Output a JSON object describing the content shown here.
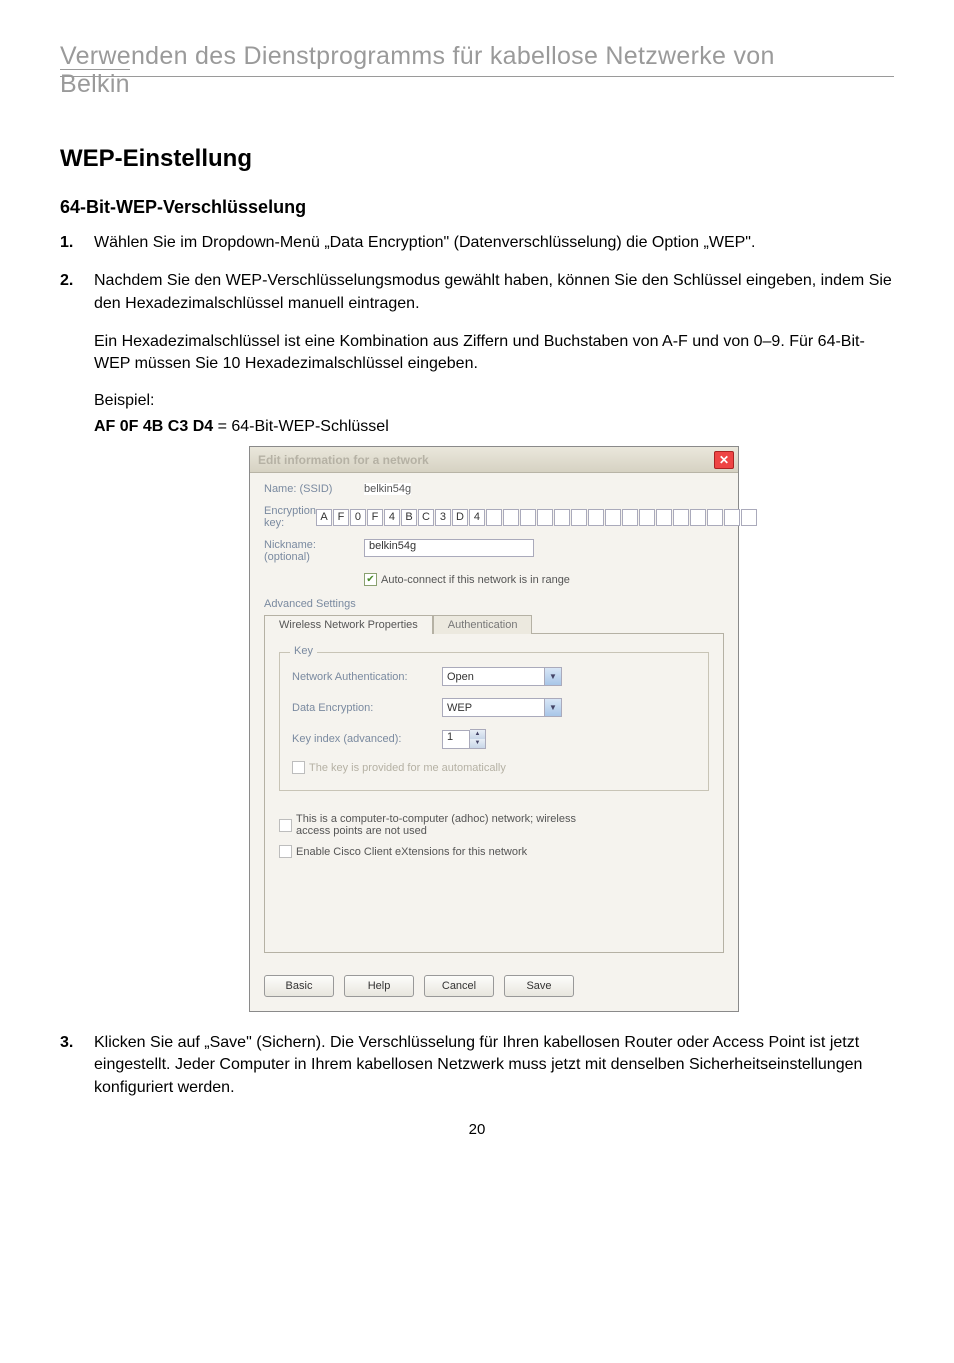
{
  "header": {
    "title": "Verwenden des Dienstprogramms für kabellose Netzwerke von",
    "sub": "Belkin"
  },
  "section_title": "WEP-Einstellung",
  "subheading": "64-Bit-WEP-Verschlüsselung",
  "steps": {
    "s1": {
      "num": "1.",
      "text": "Wählen Sie im Dropdown-Menü „Data Encryption\" (Datenverschlüsselung) die Option „WEP\"."
    },
    "s2": {
      "num": "2.",
      "text": "Nachdem Sie den WEP-Verschlüsselungsmodus gewählt haben, können Sie den Schlüssel eingeben, indem Sie den Hexadezimalschlüssel manuell eintragen."
    },
    "s3": {
      "num": "3.",
      "text": "Klicken Sie auf „Save\" (Sichern). Die Verschlüsselung für Ihren kabellosen Router oder Access Point ist jetzt eingestellt. Jeder Computer in Ihrem kabellosen Netzwerk muss jetzt mit denselben Sicherheitseinstellungen konfiguriert werden."
    }
  },
  "para_hex": "Ein Hexadezimalschlüssel ist eine Kombination aus Ziffern und Buchstaben von A-F und von 0–9. Für 64-Bit-WEP  müssen Sie 10 Hexadezimalschlüssel eingeben.",
  "para_example": "Beispiel:",
  "keyline": {
    "bold": "AF 0F 4B C3 D4",
    "rest": " = 64-Bit-WEP-Schlüssel"
  },
  "dialog": {
    "title": "Edit information for a network",
    "name_label": "Name: (SSID)",
    "name_value": "belkin54g",
    "enc_label": "Encryption key:",
    "enc_cells": [
      "A",
      "F",
      "0",
      "F",
      "4",
      "B",
      "C",
      "3",
      "D",
      "4",
      "",
      "",
      "",
      "",
      "",
      "",
      "",
      "",
      "",
      "",
      "",
      "",
      "",
      "",
      "",
      ""
    ],
    "nick_label": "Nickname:",
    "nick_opt": "(optional)",
    "nick_value": "belkin54g",
    "autoconnect_label": "Auto-connect if this network is in range",
    "advanced_label": "Advanced Settings",
    "tab1": "Wireless Network Properties",
    "tab2": "Authentication",
    "group_title": "Key",
    "auth_label": "Network Authentication:",
    "auth_value": "Open",
    "dataenc_label": "Data Encryption:",
    "dataenc_value": "WEP",
    "keyidx_label": "Key index (advanced):",
    "keyidx_value": "1",
    "autokey_label": "The key is provided for me automatically",
    "adhoc_label": "This is a computer-to-computer (adhoc) network; wireless access points are not used",
    "cisco_label": "Enable Cisco Client eXtensions for this network",
    "btn_basic": "Basic",
    "btn_help": "Help",
    "btn_cancel": "Cancel",
    "btn_save": "Save"
  },
  "page_number": "20"
}
